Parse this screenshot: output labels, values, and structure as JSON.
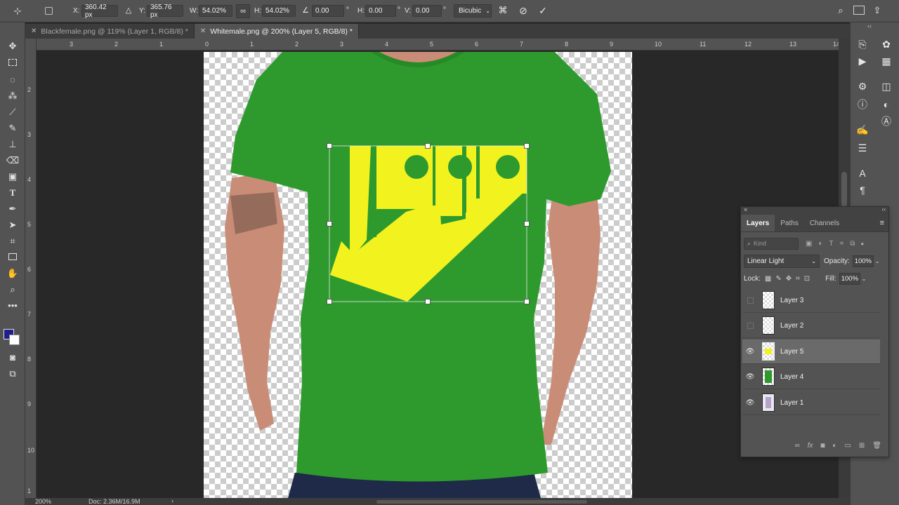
{
  "options_bar": {
    "x_label": "X:",
    "x_value": "360.42 px",
    "y_label": "Y:",
    "y_value": "365.76 px",
    "w_label": "W:",
    "w_value": "54.02%",
    "h_label": "H:",
    "h_value": "54.02%",
    "angle_value": "0.00",
    "angle_unit": "°",
    "hskew_label": "H:",
    "hskew_value": "0.00",
    "hskew_unit": "°",
    "vskew_label": "V:",
    "vskew_value": "0.00",
    "vskew_unit": "°",
    "interpolation": "Bicubic"
  },
  "tabs": [
    {
      "label": "Blackfemale.png @ 119% (Layer 1, RGB/8) *"
    },
    {
      "label": "Whitemale.png @ 200% (Layer 5, RGB/8) *"
    }
  ],
  "ruler": {
    "top": [
      "3",
      "2",
      "1",
      "0",
      "1",
      "2",
      "3",
      "4",
      "5",
      "6",
      "7",
      "8",
      "9",
      "10",
      "11",
      "12",
      "13",
      "14"
    ],
    "left": [
      "2",
      "3",
      "4",
      "5",
      "6",
      "7",
      "8",
      "9",
      "10",
      "1"
    ]
  },
  "canvas": {
    "shirt_color": "#2e9a2e",
    "logo_color": "#f2f21f",
    "skin_color": "#c98c76"
  },
  "status": {
    "zoom": "200%",
    "doc": "Doc: 2.36M/16.9M",
    "arrow": "›"
  },
  "layers_panel": {
    "tabs": [
      "Layers",
      "Paths",
      "Channels"
    ],
    "kind_placeholder": "Kind",
    "blend_mode": "Linear Light",
    "opacity_label": "Opacity:",
    "opacity_value": "100%",
    "lock_label": "Lock:",
    "fill_label": "Fill:",
    "fill_value": "100%",
    "layers": [
      {
        "name": "Layer 3",
        "visible": false
      },
      {
        "name": "Layer 2",
        "visible": false
      },
      {
        "name": "Layer 5",
        "visible": true,
        "selected": true
      },
      {
        "name": "Layer 4",
        "visible": true
      },
      {
        "name": "Layer 1",
        "visible": true
      }
    ]
  }
}
